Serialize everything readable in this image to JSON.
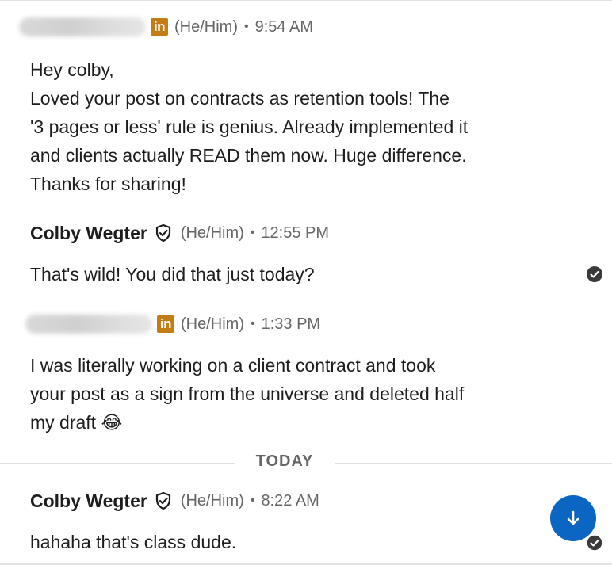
{
  "messages": [
    {
      "sender_name": "",
      "pronouns": "(He/Him)",
      "separator": "•",
      "time": "9:54 AM",
      "lines": [
        "Hey colby,",
        "Loved your post on contracts as retention tools! The",
        "'3 pages or less' rule is genius. Already implemented it",
        "and clients actually READ them now. Huge difference.",
        "Thanks for sharing!"
      ]
    },
    {
      "sender_name": "Colby Wegter",
      "pronouns": "(He/Him)",
      "separator": "•",
      "time": "12:55 PM",
      "lines": [
        "That's wild! You did that just today?"
      ]
    },
    {
      "sender_name": "",
      "pronouns": "(He/Him)",
      "separator": "•",
      "time": "1:33 PM",
      "lines": [
        "I was literally working on a client contract and took",
        "your post as a sign from the universe and deleted half",
        "my draft 😂"
      ]
    },
    {
      "sender_name": "Colby Wegter",
      "pronouns": "(He/Him)",
      "separator": "•",
      "time": "8:22 AM",
      "lines": [
        "hahaha that's class dude."
      ]
    }
  ],
  "date_divider": "TODAY",
  "linkedin_badge_text": "in",
  "icons": {
    "linkedin": "linkedin-icon",
    "verified": "verified-shield-icon",
    "seen": "seen-check-icon",
    "scroll_down": "arrow-down-icon"
  },
  "colors": {
    "linkedin_badge": "#c37d16",
    "accent_blue": "#0a66c2",
    "meta_text": "#666666",
    "body_text": "#1d1d1d"
  }
}
